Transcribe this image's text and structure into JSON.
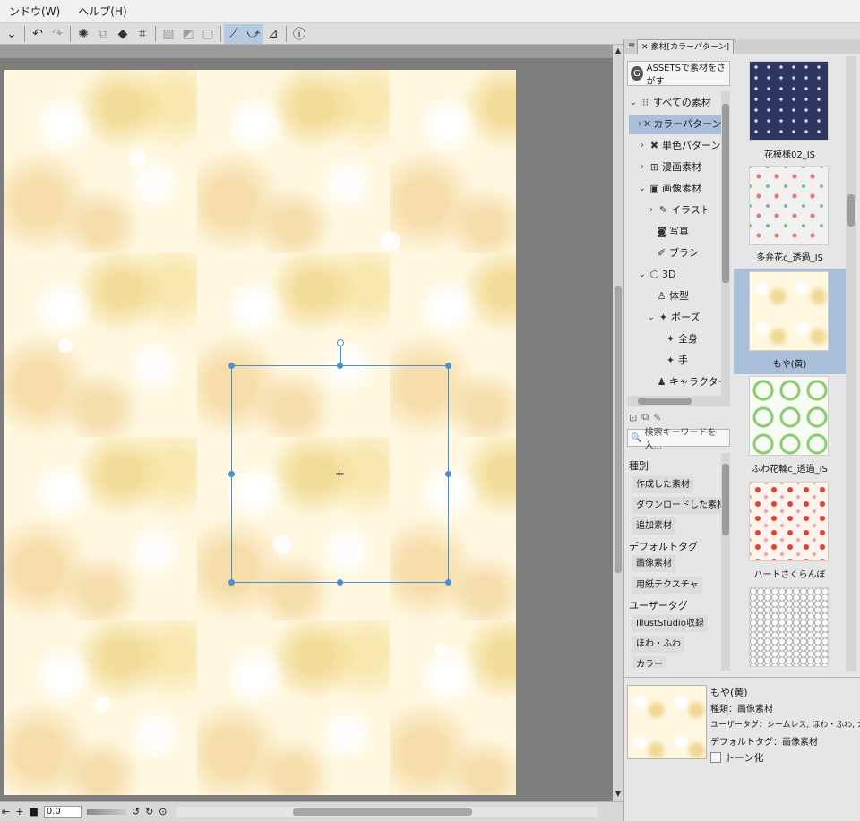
{
  "menubar": {
    "items": [
      "ンドウ(W)",
      "ヘルプ(H)"
    ]
  },
  "toolbar": {
    "icons": [
      "undo-icon",
      "redo-icon",
      "loading-icon",
      "copy-icon",
      "fill-icon",
      "crop-icon",
      "hide-selection-icon",
      "snap-off-icon",
      "snap-off-2-icon",
      "ruler-snap-icon",
      "special-ruler-snap-icon",
      "grid-snap-icon",
      "help-icon"
    ]
  },
  "canvas": {
    "zoom_value": "0.0"
  },
  "panel": {
    "tab_label": "素材[カラーパターン]",
    "assets_button": "ASSETSで素材をさがす",
    "tree": [
      {
        "label": "すべての素材",
        "expanded": true
      },
      {
        "label": "カラーパターン",
        "selected": true
      },
      {
        "label": "単色パターン"
      },
      {
        "label": "漫画素材"
      },
      {
        "label": "画像素材",
        "expanded": true
      },
      {
        "label": "イラスト"
      },
      {
        "label": "写真"
      },
      {
        "label": "ブラシ"
      },
      {
        "label": "3D",
        "expanded": true
      },
      {
        "label": "体型"
      },
      {
        "label": "ポーズ",
        "expanded": true
      },
      {
        "label": "全身"
      },
      {
        "label": "手"
      },
      {
        "label": "キャラクター"
      }
    ],
    "search_placeholder": "検索キーワードを入...",
    "tag_sections": [
      {
        "heading": "種別",
        "tags": [
          "作成した素材",
          "ダウンロードした素材",
          "追加素材"
        ]
      },
      {
        "heading": "デフォルトタグ",
        "tags": [
          "画像素材",
          "用紙テクスチャ"
        ]
      },
      {
        "heading": "ユーザータグ",
        "tags": [
          "IllustStudio収録",
          "ほわ・ふわ",
          "カラー"
        ]
      }
    ],
    "thumbnails": [
      {
        "label": "花模様02_IS",
        "pattern": "navy"
      },
      {
        "label": "多弁花c_透過_IS",
        "pattern": "pinkflower"
      },
      {
        "label": "もや(黄)",
        "pattern": "moya",
        "selected": true
      },
      {
        "label": "ふわ花輪c_透過_IS",
        "pattern": "wreath"
      },
      {
        "label": "ハートさくらんぼ",
        "pattern": "cherry"
      },
      {
        "label": "",
        "pattern": "hex"
      }
    ],
    "detail": {
      "name": "もや(黄)",
      "type": "種類：画像素材",
      "user_tags": "ユーザータグ：シームレス, ほわ・ふわ, カラー, カラ",
      "default_tags": "デフォルトタグ：画像素材",
      "tone_label": "トーン化"
    }
  }
}
